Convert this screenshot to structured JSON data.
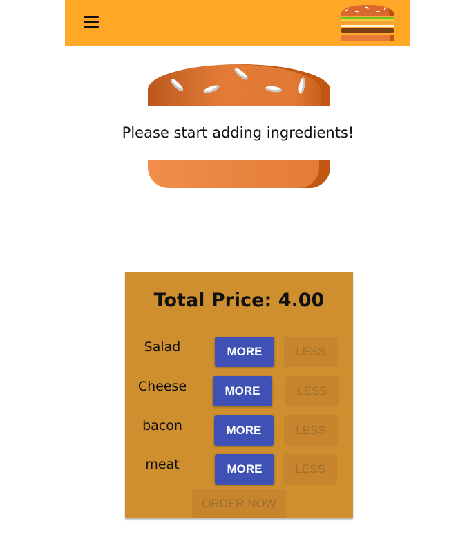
{
  "header": {
    "menu_icon": "hamburger-menu-icon",
    "logo_icon": "burger-logo-icon"
  },
  "burger": {
    "hint": "Please start adding ingredients!"
  },
  "controls": {
    "total_label": "Total Price:",
    "total_value": "4.00",
    "ingredients": [
      {
        "label": "Salad",
        "more": "MORE",
        "less": "LESS"
      },
      {
        "label": "Cheese",
        "more": "MORE",
        "less": "LESS"
      },
      {
        "label": "bacon",
        "more": "MORE",
        "less": "LESS"
      },
      {
        "label": "meat",
        "more": "MORE",
        "less": "LESS"
      }
    ],
    "order_label": "ORDER NOW"
  },
  "colors": {
    "toolbar": "#ffa726",
    "controls_bg": "#cf8f2e",
    "more_button": "#3f51b5",
    "bread": "#e27b36"
  }
}
